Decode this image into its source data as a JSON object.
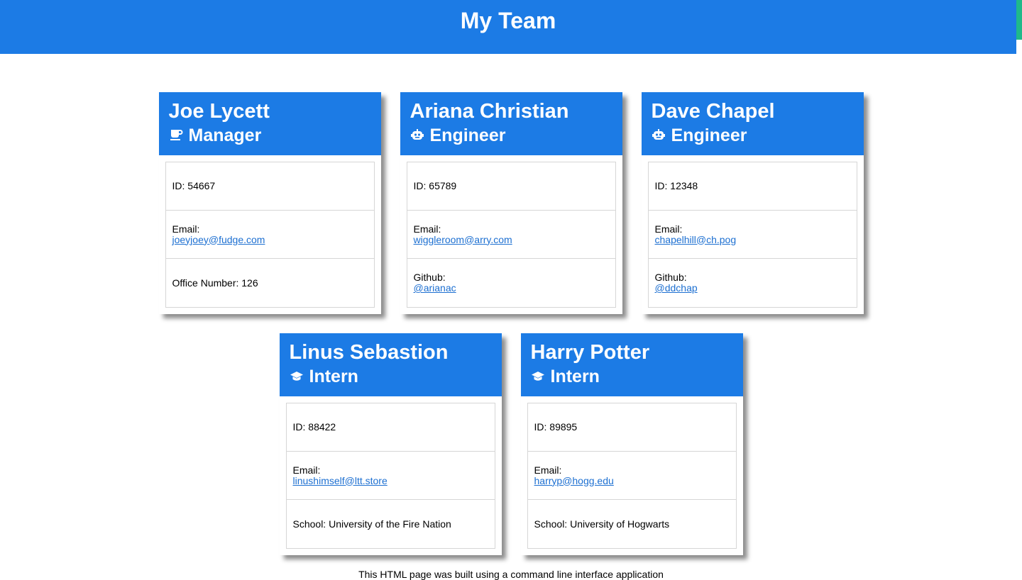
{
  "header": {
    "title": "My Team"
  },
  "colors": {
    "primary": "#1c7be5",
    "link": "#1c6fd1"
  },
  "cards": [
    {
      "name": "Joe Lycett",
      "role": "Manager",
      "icon": "coffee-icon",
      "id_text": "ID: 54667",
      "email_label": "Email:",
      "email": "joeyjoey@fudge.com",
      "extra_label": "Office Number: 126",
      "extra_link": ""
    },
    {
      "name": "Ariana Christian",
      "role": "Engineer",
      "icon": "robot-icon",
      "id_text": "ID: 65789",
      "email_label": "Email:",
      "email": "wiggleroom@arry.com",
      "extra_label": "Github:",
      "extra_link": "@arianac"
    },
    {
      "name": "Dave Chapel",
      "role": "Engineer",
      "icon": "robot-icon",
      "id_text": "ID: 12348",
      "email_label": "Email:",
      "email": "chapelhill@ch.pog",
      "extra_label": "Github:",
      "extra_link": "@ddchap"
    },
    {
      "name": "Linus Sebastion",
      "role": "Intern",
      "icon": "graduation-cap-icon",
      "id_text": "ID: 88422",
      "email_label": "Email:",
      "email": "linushimself@ltt.store",
      "extra_label": "School: University of the Fire Nation",
      "extra_link": ""
    },
    {
      "name": "Harry Potter",
      "role": "Intern",
      "icon": "graduation-cap-icon",
      "id_text": "ID: 89895",
      "email_label": "Email:",
      "email": "harryp@hogg.edu",
      "extra_label": "School: University of Hogwarts",
      "extra_link": ""
    }
  ],
  "footer": {
    "text": "This HTML page was built using a command line interface application"
  }
}
